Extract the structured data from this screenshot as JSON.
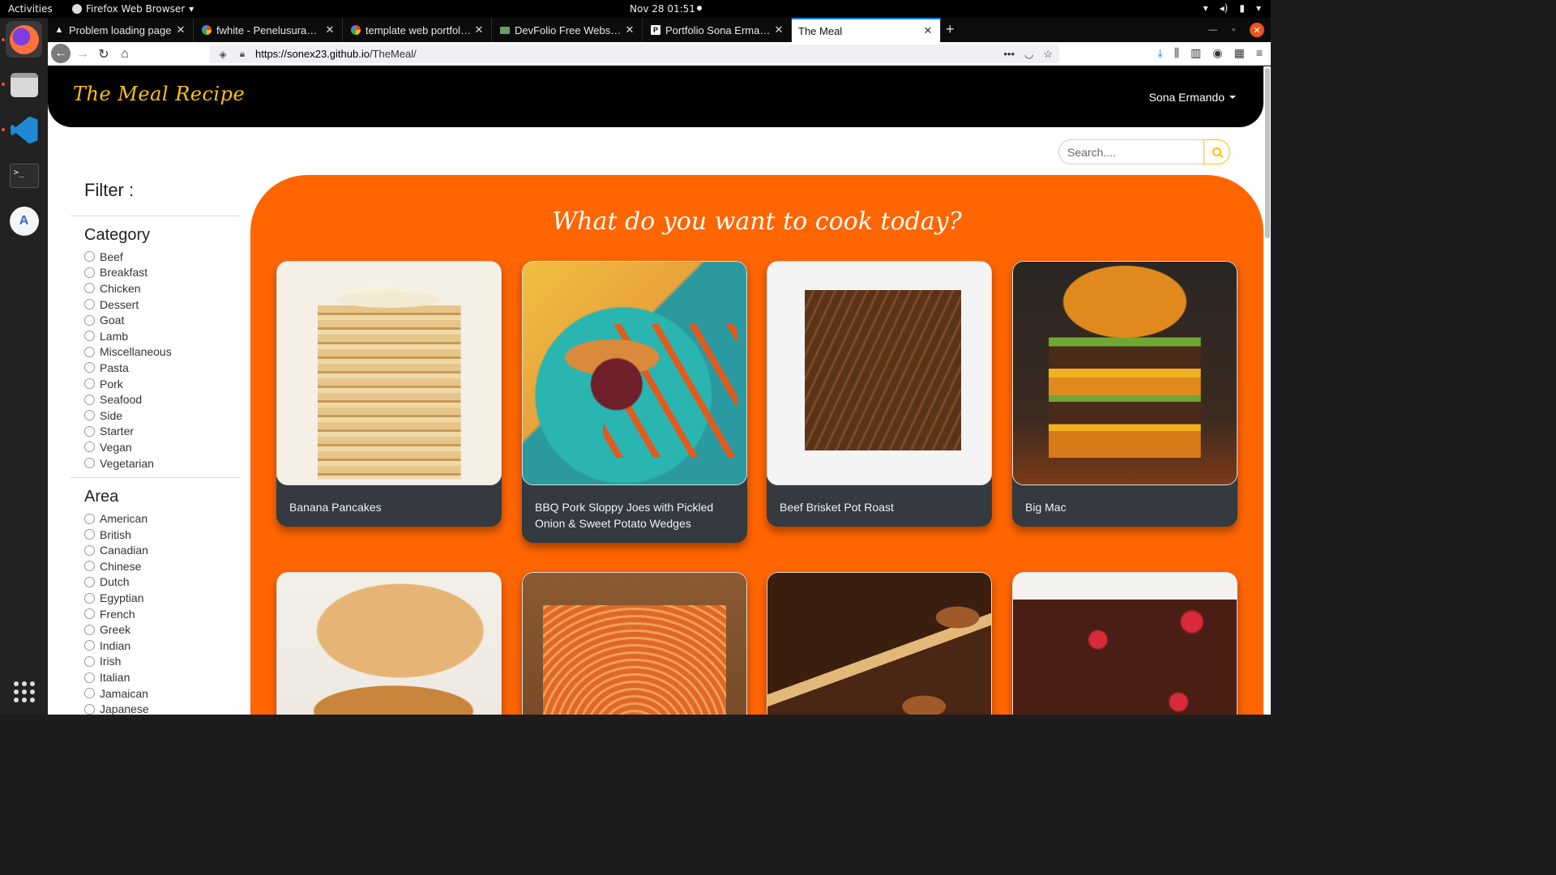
{
  "system": {
    "activities": "Activities",
    "app_menu": "Firefox Web Browser",
    "clock": "Nov 28  01:51"
  },
  "browser": {
    "tabs": [
      {
        "title": "Problem loading page",
        "icon": "warning-icon",
        "active": false
      },
      {
        "title": "fwhite - Penelusuran Google",
        "icon": "google-icon",
        "active": false
      },
      {
        "title": "template web portfolio -",
        "icon": "google-icon",
        "active": false
      },
      {
        "title": "DevFolio Free Website Template",
        "icon": "devfolio-icon",
        "active": false
      },
      {
        "title": "Portfolio Sona Ermando",
        "icon": "portfolio-icon",
        "active": false
      },
      {
        "title": "The Meal",
        "icon": "",
        "active": true
      }
    ],
    "url_scheme_host": "https://sonex23.github.io",
    "url_path": "/TheMeal/"
  },
  "site": {
    "brand": "The Meal Recipe",
    "user": "Sona Ermando",
    "search_placeholder": "Search....",
    "heading": "What do you want to cook today?"
  },
  "filter": {
    "title": "Filter :",
    "category_title": "Category",
    "categories": [
      "Beef",
      "Breakfast",
      "Chicken",
      "Dessert",
      "Goat",
      "Lamb",
      "Miscellaneous",
      "Pasta",
      "Pork",
      "Seafood",
      "Side",
      "Starter",
      "Vegan",
      "Vegetarian"
    ],
    "area_title": "Area",
    "areas": [
      "American",
      "British",
      "Canadian",
      "Chinese",
      "Dutch",
      "Egyptian",
      "French",
      "Greek",
      "Indian",
      "Irish",
      "Italian",
      "Jamaican",
      "Japanese"
    ]
  },
  "meals": [
    {
      "name": "Banana Pancakes",
      "image": "pancake"
    },
    {
      "name": "BBQ Pork Sloppy Joes with Pickled Onion & Sweet Potato Wedges",
      "image": "bbq"
    },
    {
      "name": "Beef Brisket Pot Roast",
      "image": "brisket"
    },
    {
      "name": "Big Mac",
      "image": "bigmac"
    },
    {
      "name": "",
      "image": "chicken"
    },
    {
      "name": "",
      "image": "pasta"
    },
    {
      "name": "",
      "image": "pecan"
    },
    {
      "name": "",
      "image": "brownie"
    }
  ]
}
